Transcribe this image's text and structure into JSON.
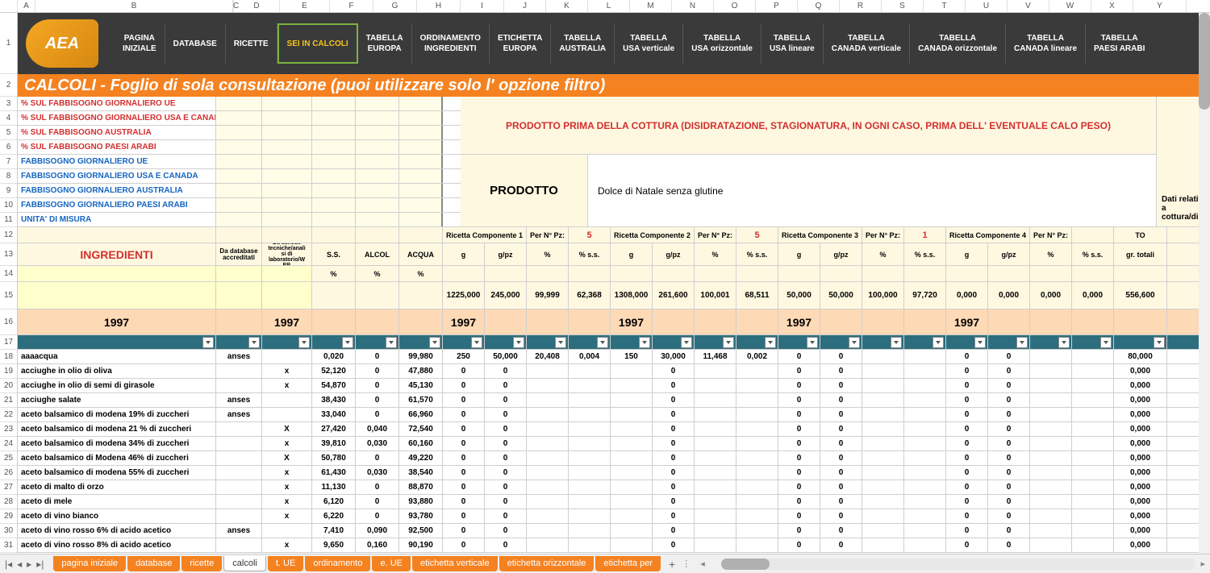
{
  "columns": [
    "A",
    "B",
    "C",
    "D",
    "E",
    "F",
    "G",
    "H",
    "I",
    "J",
    "K",
    "L",
    "M",
    "N",
    "O",
    "P",
    "Q",
    "R",
    "S",
    "T",
    "U",
    "V",
    "W",
    "X",
    "Y"
  ],
  "nav": {
    "logo": "AEA",
    "items": [
      {
        "l1": "PAGINA",
        "l2": "INIZIALE"
      },
      {
        "l1": "DATABASE",
        "l2": ""
      },
      {
        "l1": "RICETTE",
        "l2": ""
      },
      {
        "l1": "SEI IN CALCOLI",
        "l2": "",
        "active": true
      },
      {
        "l1": "TABELLA",
        "l2": "EUROPA"
      },
      {
        "l1": "ORDINAMENTO",
        "l2": "INGREDIENTI"
      },
      {
        "l1": "ETICHETTA",
        "l2": "EUROPA"
      },
      {
        "l1": "TABELLA",
        "l2": "AUSTRALIA"
      },
      {
        "l1": "TABELLA",
        "l2": "USA verticale"
      },
      {
        "l1": "TABELLA",
        "l2": "USA orizzontale"
      },
      {
        "l1": "TABELLA",
        "l2": "USA lineare"
      },
      {
        "l1": "TABELLA",
        "l2": "CANADA verticale"
      },
      {
        "l1": "TABELLA",
        "l2": "CANADA orizzontale"
      },
      {
        "l1": "TABELLA",
        "l2": "CANADA lineare"
      },
      {
        "l1": "TABELLA",
        "l2": "PAESI ARABI"
      }
    ]
  },
  "title": "CALCOLI - Foglio di sola consultazione (puoi utilizzare solo l' opzione filtro)",
  "redLabels": [
    "% SUL FABBISOGNO GIORNALIERO UE",
    "% SUL FABBISOGNO GIORNALIERO USA E CANADA",
    "% SUL FABBISOGNO AUSTRALIA",
    "% SUL FABBISOGNO PAESI ARABI"
  ],
  "blueLabels": [
    "FABBISOGNO GIORNALIERO UE",
    "FABBISOGNO GIORNALIERO USA E CANADA",
    "FABBISOGNO GIORNALIERO AUSTRALIA",
    "FABBISOGNO GIORNALIERO PAESI ARABI",
    "UNITA' DI MISURA"
  ],
  "banner": "PRODOTTO PRIMA DELLA COTTURA (DISIDRATAZIONE, STAGIONATURA, IN OGNI CASO, PRIMA DELL' EVENTUALE CALO PESO)",
  "sideNote": "Dati relativi a cottura/disid",
  "prodotto_label": "PRODOTTO",
  "prodotto_value": "Dolce di Natale senza glutine",
  "headers": {
    "ingredienti": "INGREDIENTI",
    "da_db": "Da database accreditati",
    "da_schede": "Da schede tecniche/anali si di laboratorio/W EB",
    "ss": "S.S.",
    "alcol": "ALCOL",
    "acqua": "ACQUA",
    "pct": "%",
    "ricetta1": "Ricetta Componente 1",
    "ricetta2": "Ricetta Componente 2",
    "ricetta3": "Ricetta Componente 3",
    "ricetta4": "Ricetta Componente 4",
    "per_n_pz": "Per N° Pz:",
    "pz1": "5",
    "pz2": "5",
    "pz3": "1",
    "g": "g",
    "gpz": "g/pz",
    "pct_ss": "% s.s.",
    "to": "TO",
    "gr_totali": "gr. totali"
  },
  "totals": {
    "c1": [
      "1225,000",
      "245,000",
      "99,999",
      "62,368"
    ],
    "c2": [
      "1308,000",
      "261,600",
      "100,001",
      "68,511"
    ],
    "c3": [
      "50,000",
      "50,000",
      "100,000",
      "97,720"
    ],
    "c4": [
      "0,000",
      "0,000",
      "0,000",
      "0,000"
    ],
    "gr": "556,600"
  },
  "year": "1997",
  "rows": [
    {
      "r": 18,
      "name": "aaaacqua",
      "db": "anses",
      "sch": "",
      "ss": "0,020",
      "al": "0",
      "aq": "99,980",
      "c1": [
        "250",
        "50,000",
        "20,408",
        "0,004"
      ],
      "c2": [
        "150",
        "30,000",
        "11,468",
        "0,002"
      ],
      "c3": [
        "0",
        "0",
        "",
        ""
      ],
      "c4": [
        "0",
        "0",
        "",
        ""
      ],
      "gr": "80,000"
    },
    {
      "r": 19,
      "name": "acciughe in olio di oliva",
      "db": "",
      "sch": "x",
      "ss": "52,120",
      "al": "0",
      "aq": "47,880",
      "c1": [
        "0",
        "0",
        "",
        ""
      ],
      "c2": [
        "",
        "0",
        "",
        ""
      ],
      "c3": [
        "0",
        "0",
        "",
        ""
      ],
      "c4": [
        "0",
        "0",
        "",
        ""
      ],
      "gr": "0,000"
    },
    {
      "r": 20,
      "name": "acciughe in olio di semi di girasole",
      "db": "",
      "sch": "x",
      "ss": "54,870",
      "al": "0",
      "aq": "45,130",
      "c1": [
        "0",
        "0",
        "",
        ""
      ],
      "c2": [
        "",
        "0",
        "",
        ""
      ],
      "c3": [
        "0",
        "0",
        "",
        ""
      ],
      "c4": [
        "0",
        "0",
        "",
        ""
      ],
      "gr": "0,000"
    },
    {
      "r": 21,
      "name": "acciughe salate",
      "db": "anses",
      "sch": "",
      "ss": "38,430",
      "al": "0",
      "aq": "61,570",
      "c1": [
        "0",
        "0",
        "",
        ""
      ],
      "c2": [
        "",
        "0",
        "",
        ""
      ],
      "c3": [
        "0",
        "0",
        "",
        ""
      ],
      "c4": [
        "0",
        "0",
        "",
        ""
      ],
      "gr": "0,000"
    },
    {
      "r": 22,
      "name": "aceto balsamico di modena 19% di zuccheri",
      "db": "anses",
      "sch": "",
      "ss": "33,040",
      "al": "0",
      "aq": "66,960",
      "c1": [
        "0",
        "0",
        "",
        ""
      ],
      "c2": [
        "",
        "0",
        "",
        ""
      ],
      "c3": [
        "0",
        "0",
        "",
        ""
      ],
      "c4": [
        "0",
        "0",
        "",
        ""
      ],
      "gr": "0,000"
    },
    {
      "r": 23,
      "name": "aceto balsamico di modena 21 % di zuccheri",
      "db": "",
      "sch": "X",
      "ss": "27,420",
      "al": "0,040",
      "aq": "72,540",
      "c1": [
        "0",
        "0",
        "",
        ""
      ],
      "c2": [
        "",
        "0",
        "",
        ""
      ],
      "c3": [
        "0",
        "0",
        "",
        ""
      ],
      "c4": [
        "0",
        "0",
        "",
        ""
      ],
      "gr": "0,000"
    },
    {
      "r": 24,
      "name": "aceto balsamico di modena 34% di zuccheri",
      "db": "",
      "sch": "x",
      "ss": "39,810",
      "al": "0,030",
      "aq": "60,160",
      "c1": [
        "0",
        "0",
        "",
        ""
      ],
      "c2": [
        "",
        "0",
        "",
        ""
      ],
      "c3": [
        "0",
        "0",
        "",
        ""
      ],
      "c4": [
        "0",
        "0",
        "",
        ""
      ],
      "gr": "0,000"
    },
    {
      "r": 25,
      "name": "aceto balsamico di Modena 46% di zuccheri",
      "db": "",
      "sch": "X",
      "ss": "50,780",
      "al": "0",
      "aq": "49,220",
      "c1": [
        "0",
        "0",
        "",
        ""
      ],
      "c2": [
        "",
        "0",
        "",
        ""
      ],
      "c3": [
        "0",
        "0",
        "",
        ""
      ],
      "c4": [
        "0",
        "0",
        "",
        ""
      ],
      "gr": "0,000"
    },
    {
      "r": 26,
      "name": "aceto balsamico di modena 55% di zuccheri",
      "db": "",
      "sch": "x",
      "ss": "61,430",
      "al": "0,030",
      "aq": "38,540",
      "c1": [
        "0",
        "0",
        "",
        ""
      ],
      "c2": [
        "",
        "0",
        "",
        ""
      ],
      "c3": [
        "0",
        "0",
        "",
        ""
      ],
      "c4": [
        "0",
        "0",
        "",
        ""
      ],
      "gr": "0,000"
    },
    {
      "r": 27,
      "name": "aceto di malto di orzo",
      "db": "",
      "sch": "x",
      "ss": "11,130",
      "al": "0",
      "aq": "88,870",
      "c1": [
        "0",
        "0",
        "",
        ""
      ],
      "c2": [
        "",
        "0",
        "",
        ""
      ],
      "c3": [
        "0",
        "0",
        "",
        ""
      ],
      "c4": [
        "0",
        "0",
        "",
        ""
      ],
      "gr": "0,000"
    },
    {
      "r": 28,
      "name": "aceto di mele",
      "db": "",
      "sch": "x",
      "ss": "6,120",
      "al": "0",
      "aq": "93,880",
      "c1": [
        "0",
        "0",
        "",
        ""
      ],
      "c2": [
        "",
        "0",
        "",
        ""
      ],
      "c3": [
        "0",
        "0",
        "",
        ""
      ],
      "c4": [
        "0",
        "0",
        "",
        ""
      ],
      "gr": "0,000"
    },
    {
      "r": 29,
      "name": "aceto di vino bianco",
      "db": "",
      "sch": "x",
      "ss": "6,220",
      "al": "0",
      "aq": "93,780",
      "c1": [
        "0",
        "0",
        "",
        ""
      ],
      "c2": [
        "",
        "0",
        "",
        ""
      ],
      "c3": [
        "0",
        "0",
        "",
        ""
      ],
      "c4": [
        "0",
        "0",
        "",
        ""
      ],
      "gr": "0,000"
    },
    {
      "r": 30,
      "name": "aceto di vino rosso 6% di acido acetico",
      "db": "anses",
      "sch": "",
      "ss": "7,410",
      "al": "0,090",
      "aq": "92,500",
      "c1": [
        "0",
        "0",
        "",
        ""
      ],
      "c2": [
        "",
        "0",
        "",
        ""
      ],
      "c3": [
        "0",
        "0",
        "",
        ""
      ],
      "c4": [
        "0",
        "0",
        "",
        ""
      ],
      "gr": "0,000"
    },
    {
      "r": 31,
      "name": "aceto di vino rosso 8% di acido acetico",
      "db": "",
      "sch": "x",
      "ss": "9,650",
      "al": "0,160",
      "aq": "90,190",
      "c1": [
        "0",
        "0",
        "",
        ""
      ],
      "c2": [
        "",
        "0",
        "",
        ""
      ],
      "c3": [
        "0",
        "0",
        "",
        ""
      ],
      "c4": [
        "0",
        "0",
        "",
        ""
      ],
      "gr": "0,000"
    }
  ],
  "tabs": [
    "pagina iniziale",
    "database",
    "ricette",
    "calcoli",
    "t. UE",
    "ordinamento",
    "e. UE",
    "etichetta verticale",
    "etichetta orizzontale",
    "etichetta per"
  ],
  "activeTab": "calcoli"
}
